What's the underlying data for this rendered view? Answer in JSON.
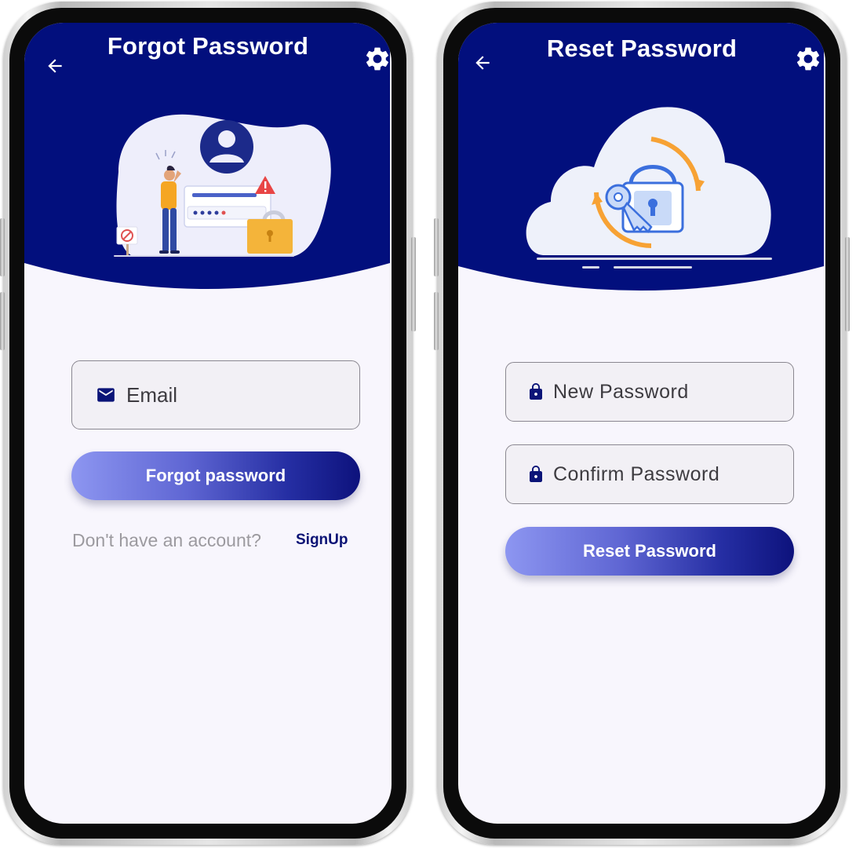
{
  "theme": {
    "primary": "#020f7d",
    "screen_bg": "#f8f6fd",
    "accent_orange": "#f7a234",
    "accent_blue": "#3b6fdd"
  },
  "forgot_screen": {
    "title": "Forgot Password",
    "back_icon": "arrow-left-icon",
    "settings_icon": "gear-icon",
    "illustration": "forgot-password-illustration",
    "email_icon": "mail-icon",
    "email_placeholder": "Email",
    "email_value": "",
    "submit_label": "Forgot password",
    "signup_prompt": "Don't have an account?",
    "signup_link": "SignUp"
  },
  "reset_screen": {
    "title": "Reset Password",
    "back_icon": "arrow-left-icon",
    "settings_icon": "gear-icon",
    "illustration": "reset-lock-illustration",
    "lock_icon": "lock-icon",
    "new_password_placeholder": "New Password",
    "new_password_value": "",
    "confirm_password_placeholder": "Confirm Password",
    "confirm_password_value": "",
    "submit_label": "Reset Password"
  }
}
